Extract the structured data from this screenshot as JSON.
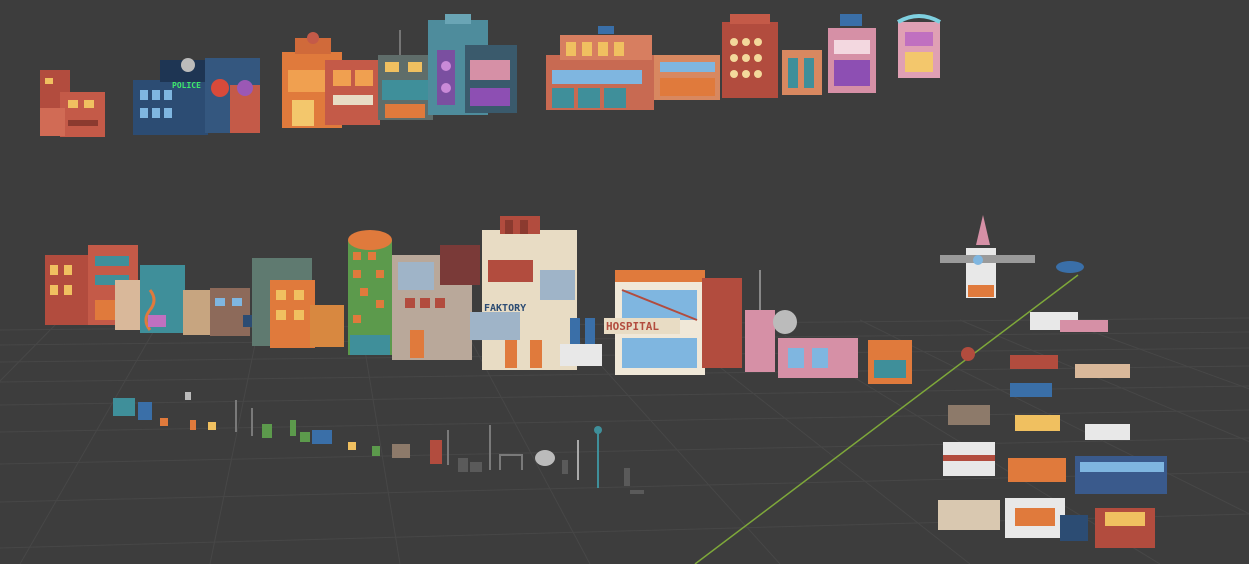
{
  "signs": {
    "police": "POLICE",
    "faktory": "FAKTORY",
    "hospital": "HOSPITAL"
  },
  "colors": {
    "background": "#3d3d3d",
    "grid_line": "#4a4a4a",
    "y_axis": "#7ea83a",
    "brick_red": "#b24c3e",
    "orange": "#e07a3c",
    "teal": "#3f8f9a",
    "navy": "#2c4c73",
    "pink": "#d690a6",
    "purple": "#7a4fa0",
    "cream": "#e8dcc4",
    "green_tower": "#5c9a4c"
  },
  "scene": {
    "background_rows": 3,
    "vehicle_count": 19,
    "prop_count": 32
  }
}
